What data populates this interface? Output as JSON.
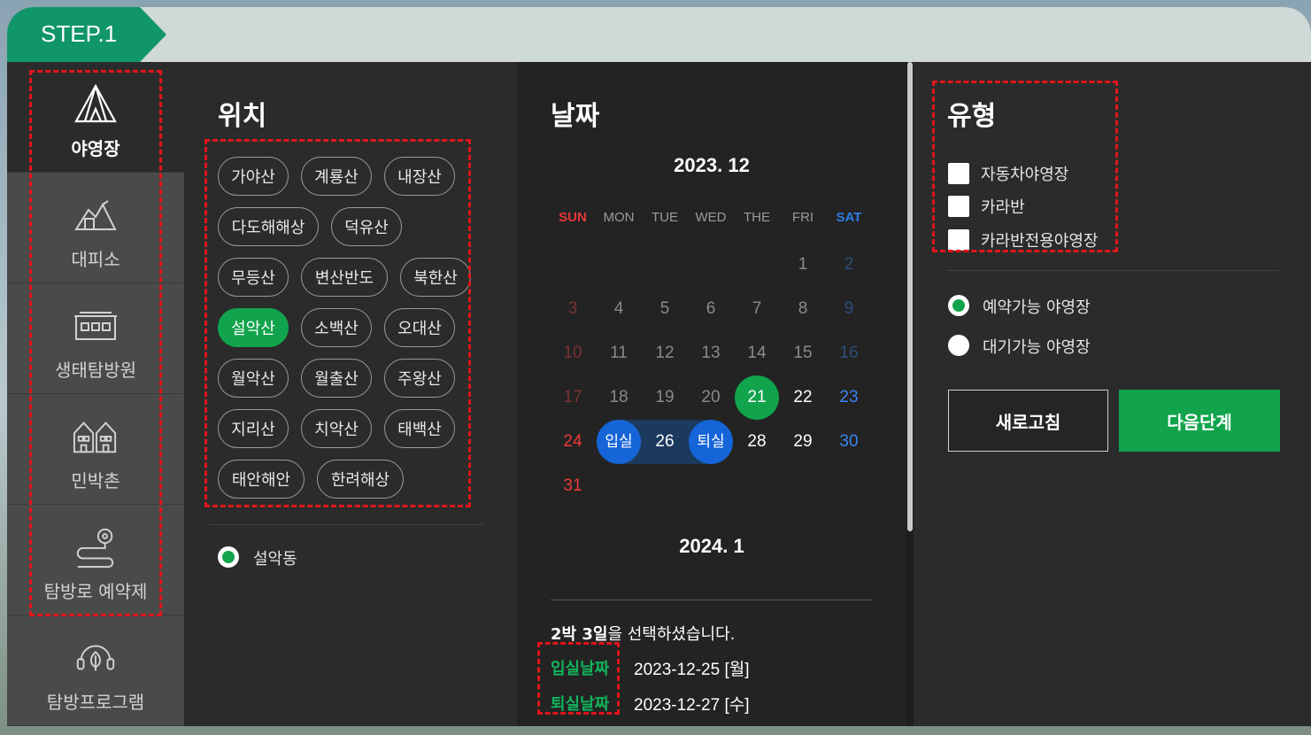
{
  "step": {
    "label": "STEP.1"
  },
  "sidebar": {
    "items": [
      {
        "label": "야영장",
        "icon": "tent-icon",
        "active": true
      },
      {
        "label": "대피소",
        "icon": "shelter-icon",
        "active": false
      },
      {
        "label": "생태탐방원",
        "icon": "eco-center-icon",
        "active": false
      },
      {
        "label": "민박촌",
        "icon": "houses-icon",
        "active": false
      },
      {
        "label": "탐방로 예약제",
        "icon": "trail-pin-icon",
        "active": false
      },
      {
        "label": "탐방프로그램",
        "icon": "program-headset-icon",
        "active": false
      }
    ]
  },
  "location": {
    "title": "위치",
    "parks": [
      "가야산",
      "계룡산",
      "내장산",
      "다도해해상",
      "덕유산",
      "무등산",
      "변산반도",
      "북한산",
      "설악산",
      "소백산",
      "오대산",
      "월악산",
      "월출산",
      "주왕산",
      "지리산",
      "치악산",
      "태백산",
      "태안해안",
      "한려해상"
    ],
    "selected": "설악산",
    "sub_option": "설악동"
  },
  "date": {
    "title": "날짜",
    "month1": "2023. 12",
    "month2": "2024. 1",
    "weekdays": [
      "SUN",
      "MON",
      "TUE",
      "WED",
      "THE",
      "FRI",
      "SAT"
    ],
    "checkin_label": "입실",
    "checkout_label": "퇴실",
    "summary_bold": "2박 3일",
    "summary_rest": "을 선택하셨습니다.",
    "checkin_title": "입실날짜",
    "checkin_value": "2023-12-25 [월]",
    "checkout_title": "퇴실날짜",
    "checkout_value": "2023-12-27 [수]"
  },
  "type": {
    "title": "유형",
    "checkboxes": [
      "자동차야영장",
      "카라반",
      "카라반전용야영장"
    ],
    "radios": [
      {
        "label": "예약가능 야영장",
        "selected": true
      },
      {
        "label": "대기가능 야영장",
        "selected": false
      }
    ],
    "refresh_label": "새로고침",
    "next_label": "다음단계"
  },
  "colors": {
    "accent": "#11a44c",
    "selection": "#1565d8",
    "step_tab": "#11956b",
    "highlight": "#e3141b"
  }
}
